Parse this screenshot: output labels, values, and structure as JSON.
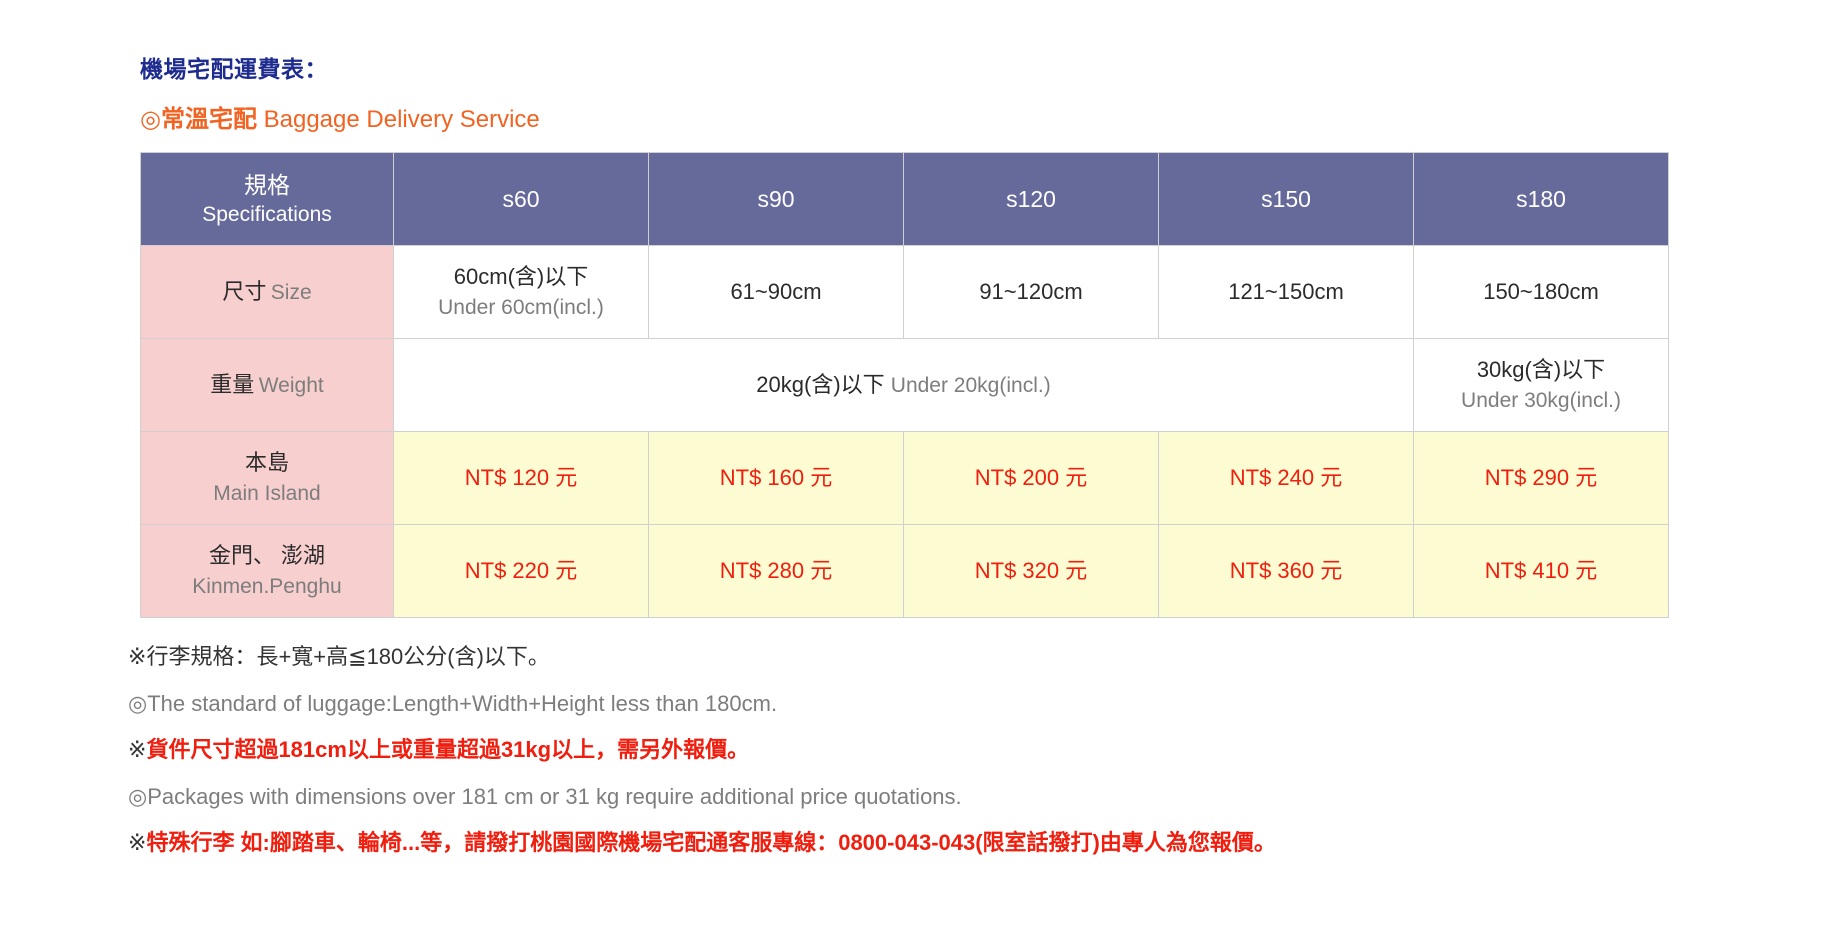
{
  "heading": {
    "main_title": "機場宅配運費表：",
    "sub_title_cjk": "◎常溫宅配",
    "sub_title_latin": " Baggage Delivery Service"
  },
  "table": {
    "header": {
      "spec_cjk": "規格",
      "spec_latin": "Specifications",
      "columns": [
        "s60",
        "s90",
        "s120",
        "s150",
        "s180"
      ]
    },
    "rows": {
      "size": {
        "label_cjk": "尺寸",
        "label_latin": "Size",
        "values": [
          {
            "cjk": "60cm(含)以下",
            "latin": "Under 60cm(incl.)"
          },
          {
            "cjk": "61~90cm",
            "latin": ""
          },
          {
            "cjk": "91~120cm",
            "latin": ""
          },
          {
            "cjk": "121~150cm",
            "latin": ""
          },
          {
            "cjk": "150~180cm",
            "latin": ""
          }
        ]
      },
      "weight": {
        "label_cjk": "重量",
        "label_latin": "Weight",
        "merged_cjk": "20kg(含)以下",
        "merged_latin": "Under 20kg(incl.)",
        "last_cjk": "30kg(含)以下",
        "last_latin": "Under 30kg(incl.)"
      },
      "main_island": {
        "label_cjk": "本島",
        "label_latin": "Main Island",
        "prices": [
          "NT$ 120 元",
          "NT$ 160 元",
          "NT$ 200 元",
          "NT$ 240 元",
          "NT$ 290 元"
        ]
      },
      "kinmen_penghu": {
        "label_cjk": "金門、 澎湖",
        "label_latin": "Kinmen.Penghu",
        "prices": [
          "NT$ 220 元",
          "NT$ 280 元",
          "NT$ 320 元",
          "NT$ 360 元",
          "NT$ 410 元"
        ]
      }
    }
  },
  "notes": [
    {
      "mark": "※",
      "text": "行李規格：長+寬+高≦180公分(含)以下。",
      "style": "dark"
    },
    {
      "mark": "◎",
      "text": "The standard of luggage:Length+Width+Height less than 180cm.",
      "style": "gray"
    },
    {
      "mark": "※",
      "text": "貨件尺寸超過181cm以上或重量超過31kg以上，需另外報價。",
      "style": "red"
    },
    {
      "mark": "◎",
      "text": "Packages with dimensions over 181 cm or 31 kg require additional price quotations.",
      "style": "gray"
    },
    {
      "mark": "※",
      "text": "特殊行李 如:腳踏車、輪椅...等，請撥打桃園國際機場宅配通客服專線：0800-043-043(限室話撥打)由專人為您報價。",
      "style": "red"
    }
  ],
  "colors": {
    "title_blue": "#1f2c8f",
    "subtitle_orange": "#f26322",
    "header_purple": "#666a9b",
    "label_pink": "#f8cfcf",
    "price_yellow": "#fcfbd2",
    "price_red": "#f01e0e",
    "latin_gray": "#7d7d7d"
  }
}
